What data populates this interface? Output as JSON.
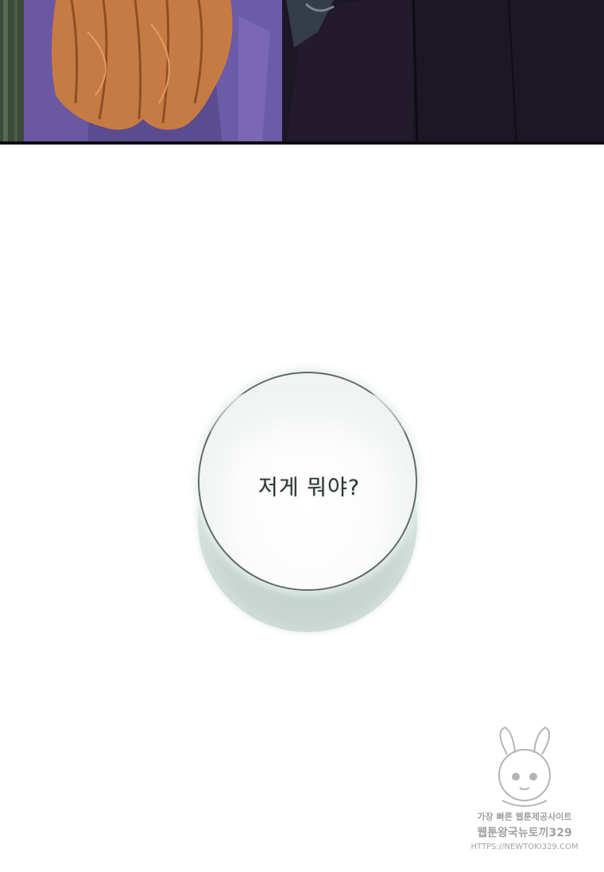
{
  "speech_bubble": {
    "text": "저게 뭐야?"
  },
  "watermark": {
    "line1": "가장 빠른 웹툰제공사이트",
    "line2": "웹툰왕국뉴토끼329",
    "line3": "HTTPS://NEWTOKI329.COM"
  }
}
